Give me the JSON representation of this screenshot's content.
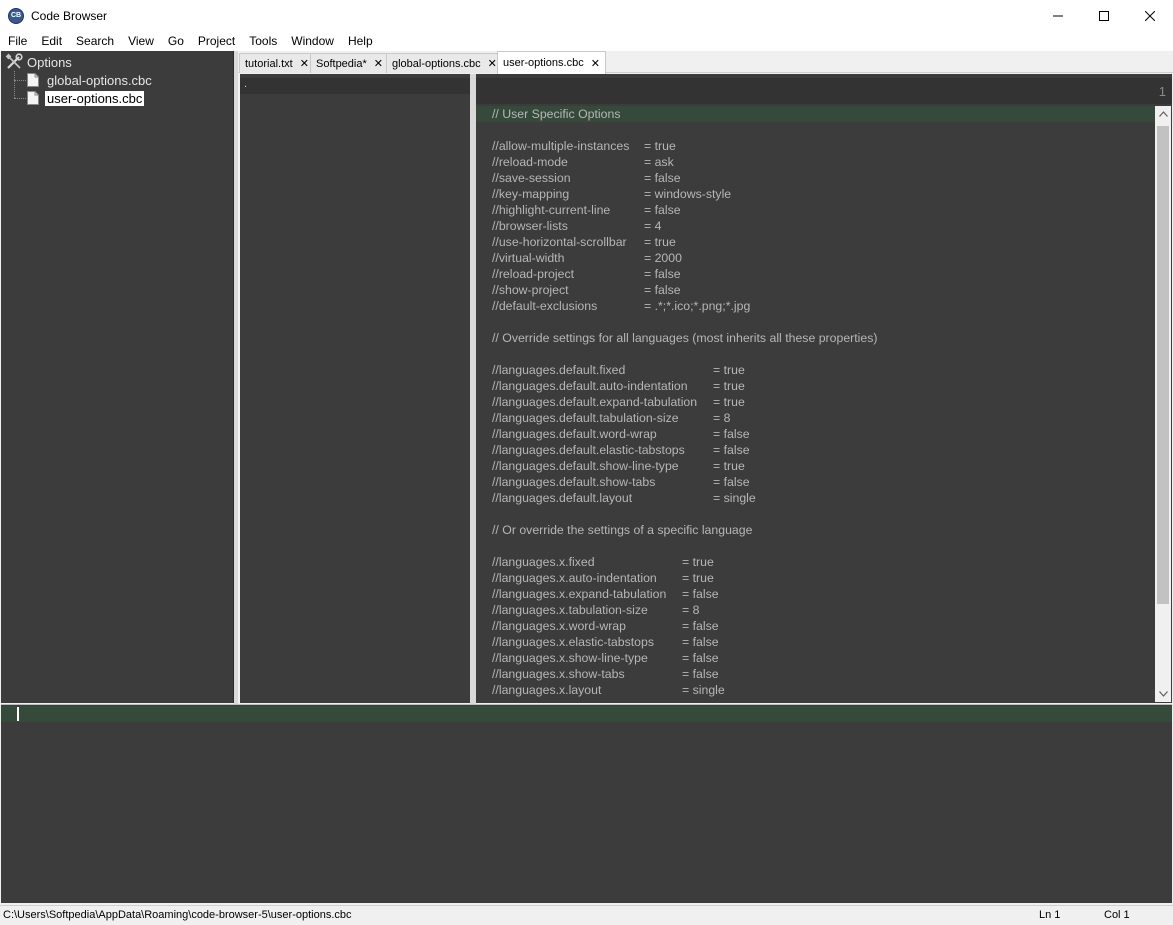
{
  "window": {
    "title": "Code Browser",
    "icon": "code-browser-app-icon",
    "icon_text": "CB"
  },
  "menu": {
    "items": [
      "File",
      "Edit",
      "Search",
      "View",
      "Go",
      "Project",
      "Tools",
      "Window",
      "Help"
    ]
  },
  "tree": {
    "root_label": "Options",
    "root_icon": "tools-icon",
    "items": [
      {
        "label": "global-options.cbc",
        "icon": "file-icon",
        "selected": false
      },
      {
        "label": "user-options.cbc",
        "icon": "file-icon",
        "selected": true
      }
    ]
  },
  "tabs": [
    {
      "label": "tutorial.txt",
      "active": false
    },
    {
      "label": "Softpedia*",
      "active": false
    },
    {
      "label": "global-options.cbc",
      "active": false
    },
    {
      "label": "user-options.cbc",
      "active": true
    }
  ],
  "list_pane": {
    "filter_text": "."
  },
  "editor": {
    "line_number": "1",
    "lines": [
      {
        "key": "// User Specific Options",
        "val": ""
      },
      {
        "key": "",
        "val": ""
      },
      {
        "key": "//allow-multiple-instances",
        "val": "= true"
      },
      {
        "key": "//reload-mode",
        "val": "= ask"
      },
      {
        "key": "//save-session",
        "val": "= false"
      },
      {
        "key": "//key-mapping",
        "val": "= windows-style"
      },
      {
        "key": "//highlight-current-line",
        "val": "= false"
      },
      {
        "key": "//browser-lists",
        "val": "= 4"
      },
      {
        "key": "//use-horizontal-scrollbar",
        "val": "= true"
      },
      {
        "key": "//virtual-width",
        "val": "= 2000"
      },
      {
        "key": "//reload-project",
        "val": "= false"
      },
      {
        "key": "//show-project",
        "val": "= false"
      },
      {
        "key": "//default-exclusions",
        "val": "= .*;*.ico;*.png;*.jpg"
      },
      {
        "key": "",
        "val": ""
      },
      {
        "key": "// Override settings for all languages (most inherits all these properties)",
        "val": ""
      },
      {
        "key": "",
        "val": ""
      },
      {
        "key": "//languages.default.fixed",
        "val": "= true"
      },
      {
        "key": "//languages.default.auto-indentation",
        "val": "= true"
      },
      {
        "key": "//languages.default.expand-tabulation",
        "val": "= true"
      },
      {
        "key": "//languages.default.tabulation-size",
        "val": "= 8"
      },
      {
        "key": "//languages.default.word-wrap",
        "val": "= false"
      },
      {
        "key": "//languages.default.elastic-tabstops",
        "val": "= false"
      },
      {
        "key": "//languages.default.show-line-type",
        "val": "= true"
      },
      {
        "key": "//languages.default.show-tabs",
        "val": "= false"
      },
      {
        "key": "//languages.default.layout",
        "val": "= single"
      },
      {
        "key": "",
        "val": ""
      },
      {
        "key": "// Or override the settings of a specific language",
        "val": ""
      },
      {
        "key": "",
        "val": ""
      },
      {
        "key": "//languages.x.fixed",
        "val": "= true"
      },
      {
        "key": "//languages.x.auto-indentation",
        "val": "= true"
      },
      {
        "key": "//languages.x.expand-tabulation",
        "val": "= false"
      },
      {
        "key": "//languages.x.tabulation-size",
        "val": "= 8"
      },
      {
        "key": "//languages.x.word-wrap",
        "val": "= false"
      },
      {
        "key": "//languages.x.elastic-tabstops",
        "val": "= false"
      },
      {
        "key": "//languages.x.show-line-type",
        "val": "= false"
      },
      {
        "key": "//languages.x.show-tabs",
        "val": "= false"
      },
      {
        "key": "//languages.x.layout",
        "val": "= single"
      }
    ]
  },
  "statusbar": {
    "path": "C:\\Users\\Softpedia\\AppData\\Roaming\\code-browser-5\\user-options.cbc",
    "line": "Ln 1",
    "column": "Col 1"
  },
  "colors": {
    "editor_bg": "#3c3c3c",
    "current_line_bg": "#364a3c",
    "code_text": "#b6b6b6"
  }
}
